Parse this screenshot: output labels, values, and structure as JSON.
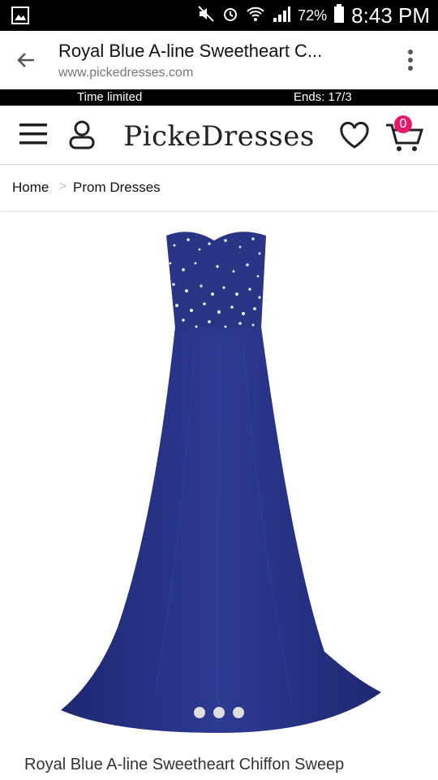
{
  "status_bar": {
    "battery": "72%",
    "time": "8:43 PM"
  },
  "browser": {
    "title": "Royal Blue A-line Sweetheart C...",
    "url": "www.pickedresses.com"
  },
  "promo": {
    "left": "Time limited",
    "right": "Ends: 17/3"
  },
  "site": {
    "logo": "PickeDresses",
    "cart_count": "0"
  },
  "breadcrumb": {
    "home": "Home",
    "separator": ">",
    "category": "Prom Dresses"
  },
  "product": {
    "title": "Royal Blue A-line Sweetheart Chiffon Sweep",
    "dress_color": "#2a3585",
    "image_slides": 3,
    "active_slide": 1
  },
  "colors": {
    "badge": "#e8196a",
    "dress": "#2a3585"
  }
}
